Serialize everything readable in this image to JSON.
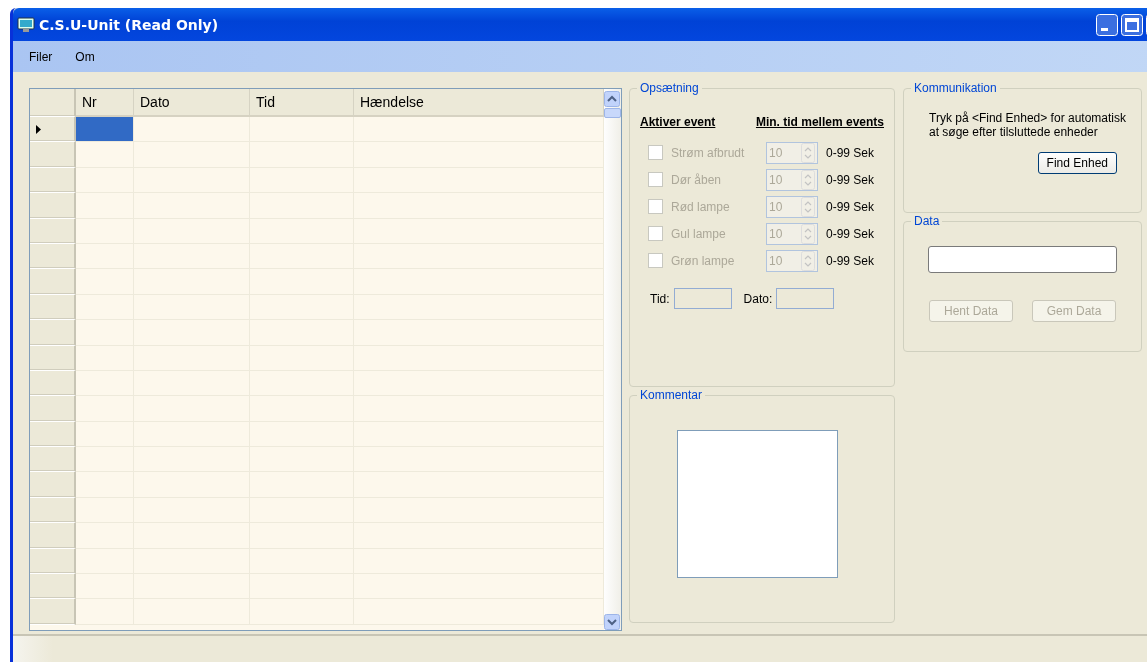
{
  "window": {
    "title": "C.S.U-Unit (Read Only)"
  },
  "menu": [
    "Filer",
    "Om"
  ],
  "table": {
    "columns": [
      "Nr",
      "Dato",
      "Tid",
      "Hændelse"
    ],
    "rows": [
      {
        "selected": true
      },
      {
        "selected": false
      },
      {
        "selected": false
      },
      {
        "selected": false
      },
      {
        "selected": false
      },
      {
        "selected": false
      },
      {
        "selected": false
      },
      {
        "selected": false
      },
      {
        "selected": false
      },
      {
        "selected": false
      },
      {
        "selected": false
      },
      {
        "selected": false
      },
      {
        "selected": false
      },
      {
        "selected": false
      },
      {
        "selected": false
      },
      {
        "selected": false
      },
      {
        "selected": false
      },
      {
        "selected": false
      },
      {
        "selected": false
      },
      {
        "selected": false
      }
    ]
  },
  "setup": {
    "title": "Opsætning",
    "heading_1": "Aktiver event",
    "heading_2": "Min. tid mellem events",
    "events": [
      {
        "label": "Strøm afbrudt",
        "checked": false,
        "disabled": true,
        "value": "10",
        "unit": "0-99 Sek"
      },
      {
        "label": "Dør åben",
        "checked": false,
        "disabled": true,
        "value": "10",
        "unit": "0-99 Sek"
      },
      {
        "label": "Rød lampe",
        "checked": false,
        "disabled": true,
        "value": "10",
        "unit": "0-99 Sek"
      },
      {
        "label": "Gul lampe",
        "checked": false,
        "disabled": true,
        "value": "10",
        "unit": "0-99 Sek"
      },
      {
        "label": "Grøn lampe",
        "checked": false,
        "disabled": true,
        "value": "10",
        "unit": "0-99 Sek"
      }
    ],
    "time_label": "Tid:",
    "date_label": "Dato:"
  },
  "comment": {
    "title": "Kommentar"
  },
  "communication": {
    "title": "Kommunikation",
    "text": "Tryk på <Find Enhed> for automatisk at søge efter tilsluttede enheder",
    "button": "Find Enhed"
  },
  "data": {
    "title": "Data",
    "buttons": [
      {
        "label": "Hent Data",
        "disabled": true
      },
      {
        "label": "Gem Data",
        "disabled": true
      }
    ]
  }
}
